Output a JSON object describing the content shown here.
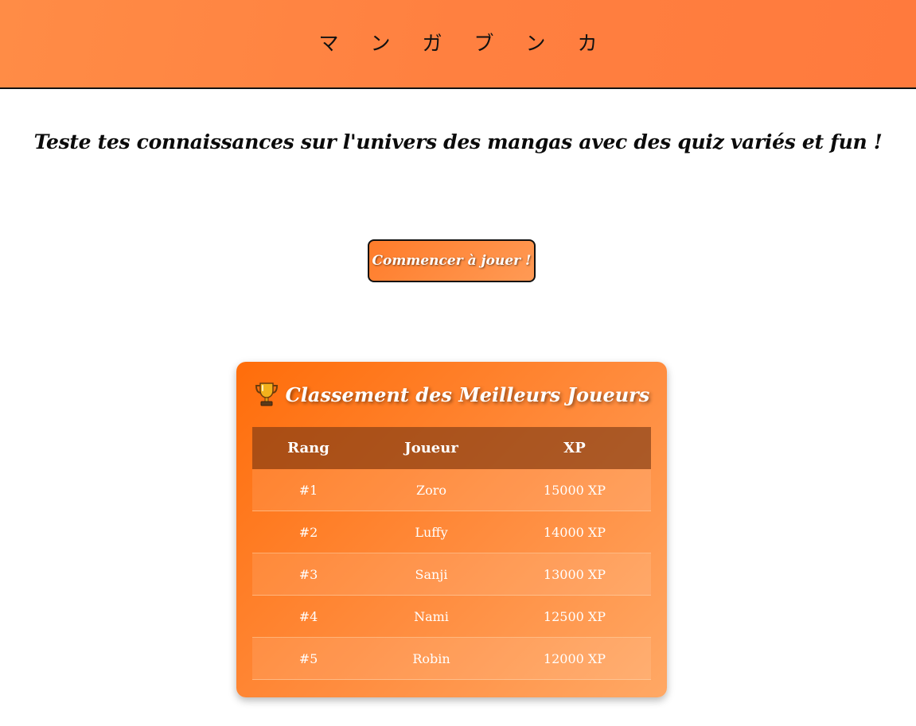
{
  "header": {
    "site_title": "マンガブンカ"
  },
  "main": {
    "tagline": "Teste tes connaissances sur l'univers des mangas avec des quiz variés et fun !",
    "play_button_label": "Commencer à jouer !"
  },
  "leaderboard": {
    "title_icon": "trophy-icon",
    "title": "Classement des Meilleurs Joueurs",
    "columns": [
      "Rang",
      "Joueur",
      "XP"
    ],
    "rows": [
      {
        "rank": "#1",
        "player": "Zoro",
        "xp": "15000 XP"
      },
      {
        "rank": "#2",
        "player": "Luffy",
        "xp": "14000 XP"
      },
      {
        "rank": "#3",
        "player": "Sanji",
        "xp": "13000 XP"
      },
      {
        "rank": "#4",
        "player": "Nami",
        "xp": "12500 XP"
      },
      {
        "rank": "#5",
        "player": "Robin",
        "xp": "12000 XP"
      }
    ]
  },
  "colors": {
    "header_orange": "#ff8444",
    "card_orange_start": "#ff6d0a",
    "card_orange_end": "#ffa865",
    "table_header_brown": "#a95a26",
    "text_dark": "#0b0b0b",
    "text_light": "#ffffff"
  }
}
